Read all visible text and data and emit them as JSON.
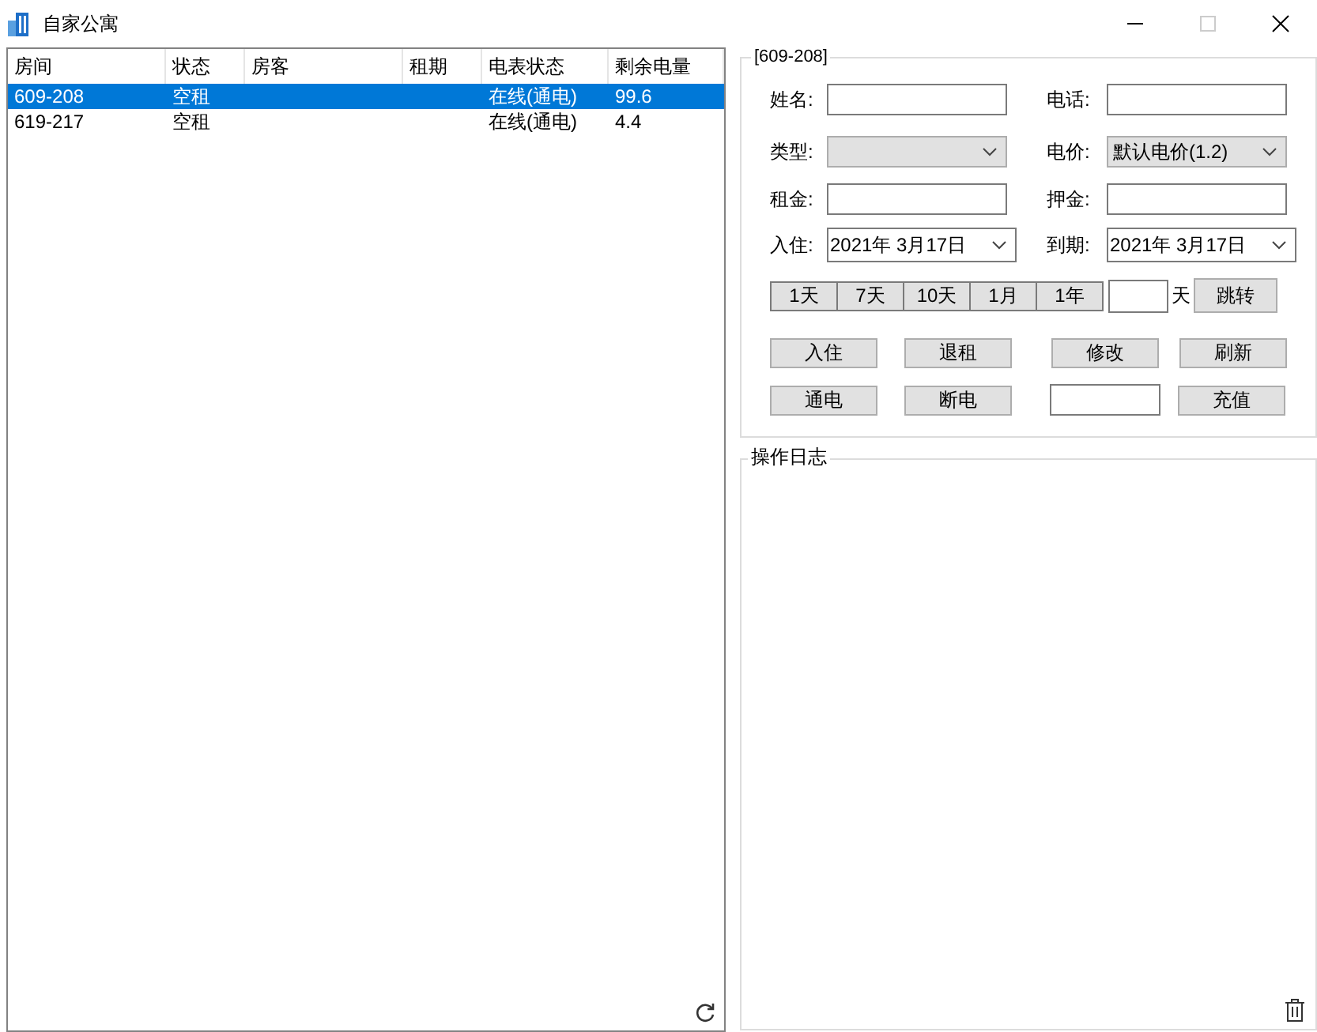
{
  "window": {
    "title": "自家公寓"
  },
  "table": {
    "columns": [
      "房间",
      "状态",
      "房客",
      "租期",
      "电表状态",
      "剩余电量"
    ],
    "rows": [
      {
        "cells": [
          "609-208",
          "空租",
          "",
          "",
          "在线(通电)",
          "99.6"
        ],
        "selected": true
      },
      {
        "cells": [
          "619-217",
          "空租",
          "",
          "",
          "在线(通电)",
          "4.4"
        ],
        "selected": false
      }
    ]
  },
  "room_panel": {
    "title": "[609-208]",
    "fields": [
      {
        "label": "姓名:",
        "kind": "text"
      },
      {
        "label": "电话:",
        "kind": "text"
      },
      {
        "label": "类型:",
        "kind": "select"
      },
      {
        "label": "电价:",
        "kind": "select",
        "value": "默认电价(1.2)"
      },
      {
        "label": "租金:",
        "kind": "text"
      },
      {
        "label": "押金:",
        "kind": "text"
      },
      {
        "label": "入住:",
        "kind": "date",
        "value": "2021年 3月17日"
      },
      {
        "label": "到期:",
        "kind": "date",
        "value": "2021年 3月17日"
      }
    ],
    "quick_buttons": [
      "1天",
      "7天",
      "10天",
      "1月",
      "1年"
    ],
    "days_unit": "天",
    "jump_button": "跳转",
    "buttons_row_1": [
      "入住",
      "退租",
      "修改",
      "刷新"
    ],
    "buttons_row_2": [
      "通电",
      "断电"
    ],
    "recharge_button": "充值"
  },
  "log_panel": {
    "title": "操作日志"
  }
}
